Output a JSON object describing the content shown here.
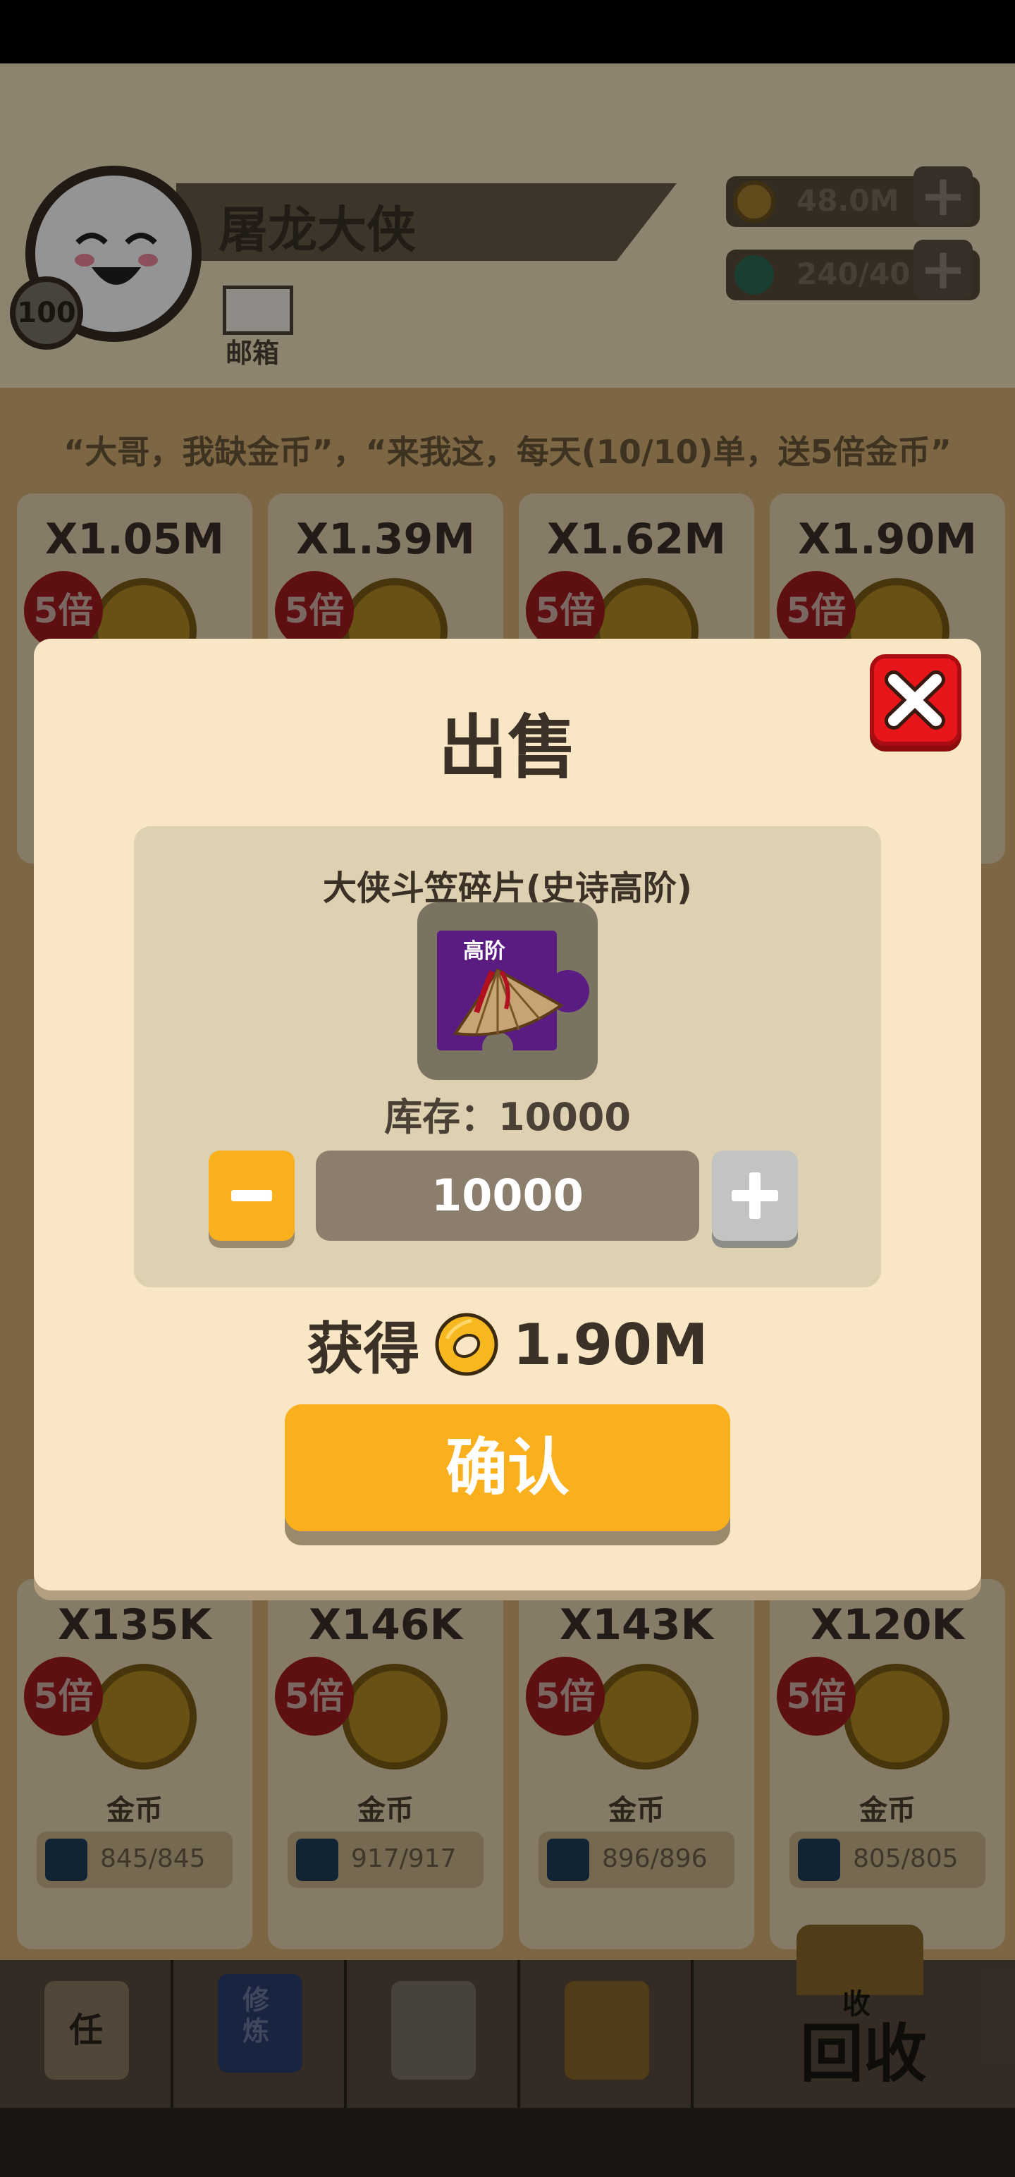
{
  "header": {
    "player_name": "屠龙大侠",
    "level": "100",
    "mail_label": "邮箱",
    "gold": "48.0M",
    "stamina": "240/40"
  },
  "quote": "“大哥，我缺金币”，“来我这，每天(10/10)单，送5倍金币”",
  "top_cards": [
    {
      "mult": "X1.05M",
      "badge": "5倍"
    },
    {
      "mult": "X1.39M",
      "badge": "5倍"
    },
    {
      "mult": "X1.62M",
      "badge": "5倍"
    },
    {
      "mult": "X1.90M",
      "badge": "5倍"
    }
  ],
  "bottom_cards": [
    {
      "mult": "X135K",
      "badge": "5倍",
      "label": "金币",
      "progress": "845/845"
    },
    {
      "mult": "X146K",
      "badge": "5倍",
      "label": "金币",
      "progress": "917/917"
    },
    {
      "mult": "X143K",
      "badge": "5倍",
      "label": "金币",
      "progress": "896/896"
    },
    {
      "mult": "X120K",
      "badge": "5倍",
      "label": "金币",
      "progress": "805/805"
    }
  ],
  "nav": {
    "task_label": "任",
    "cultivate_label": "修炼",
    "recycle_small": "收",
    "recycle_label": "回收"
  },
  "dialog": {
    "title": "出售",
    "item_name": "大侠斗笠碎片(史诗高阶)",
    "item_tag": "高阶",
    "stock_text": "库存：10000",
    "quantity": "10000",
    "gain_label": "获得",
    "gain_value": "1.90M",
    "confirm_label": "确认"
  },
  "colors": {
    "accent_orange": "#fab01d",
    "close_red": "#e8161b",
    "dialog_bg": "#f8e6c4",
    "panel_bg": "#ddd1b1",
    "item_purple": "#5a1b83"
  }
}
